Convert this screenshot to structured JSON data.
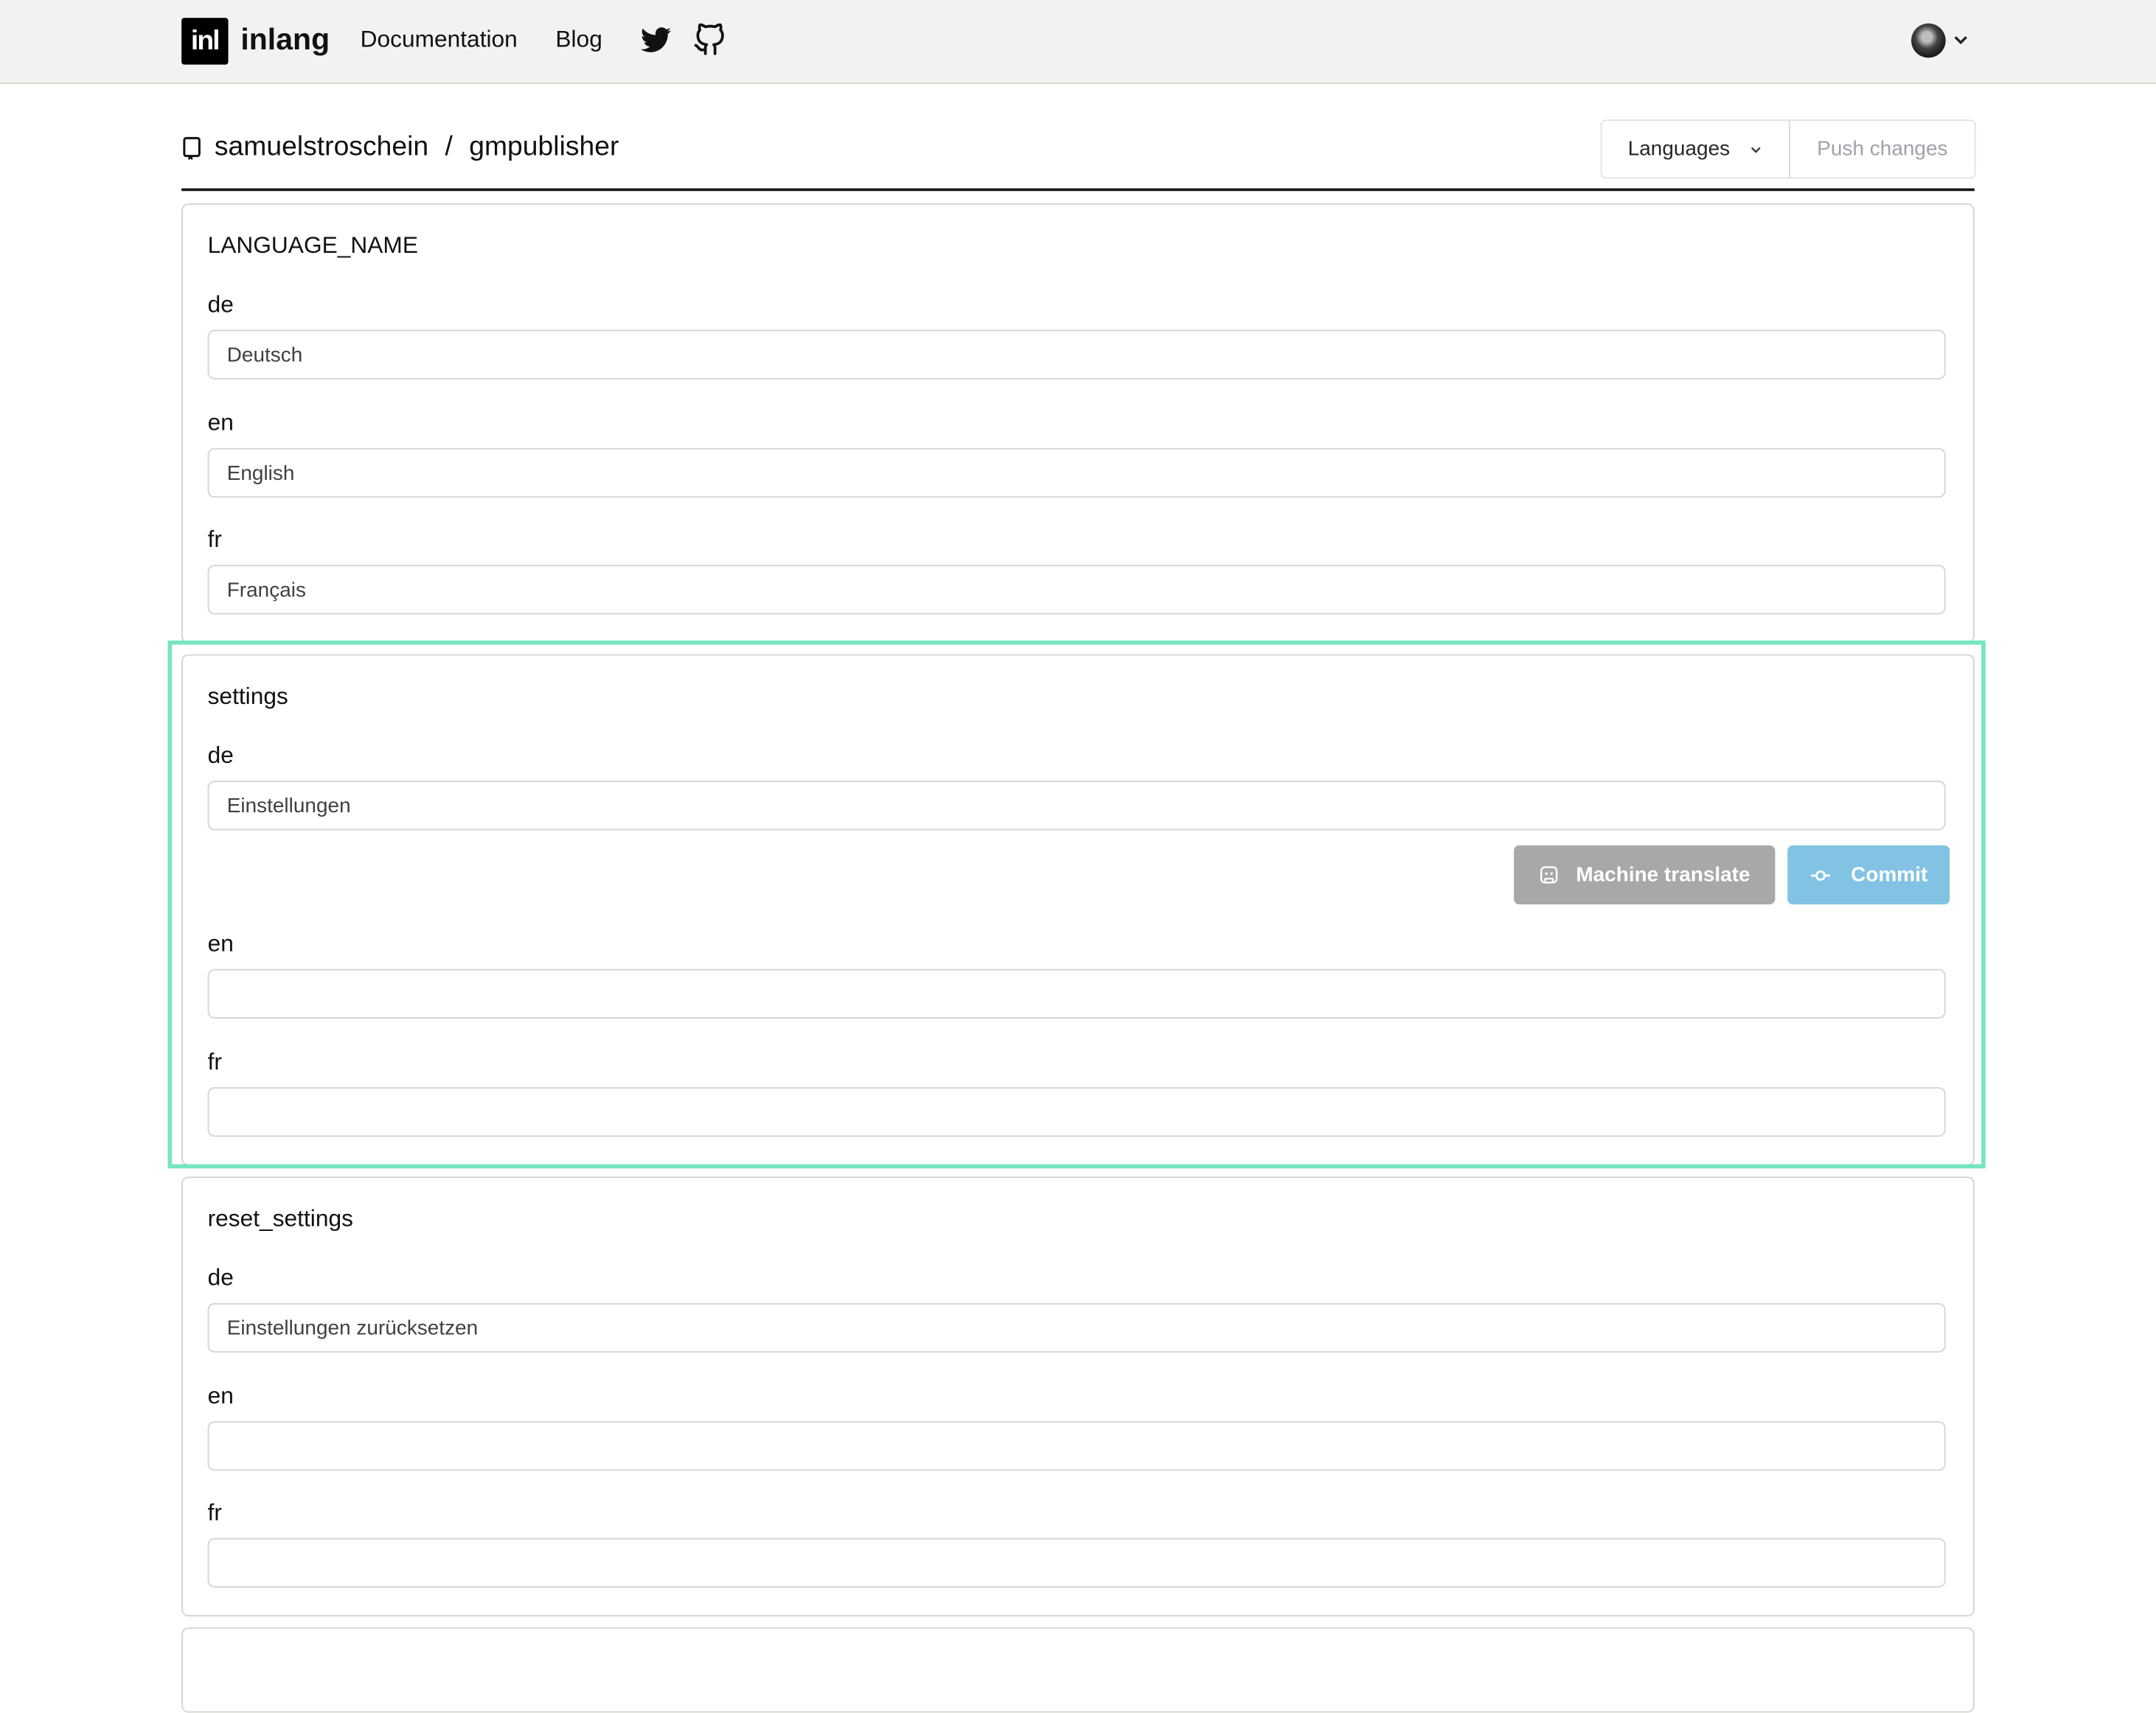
{
  "header": {
    "logo_text": "inl",
    "brand": "inlang",
    "nav": [
      {
        "label": "Documentation"
      },
      {
        "label": "Blog"
      }
    ],
    "icons": [
      "twitter-icon",
      "github-icon"
    ],
    "user_menu": {
      "avatar": "user-avatar",
      "chevron": "chevron-down-icon"
    }
  },
  "repo": {
    "owner": "samuelstroschein",
    "separator": "/",
    "name": "gmpublisher"
  },
  "toolbar": {
    "languages_label": "Languages",
    "push_label": "Push changes"
  },
  "colors": {
    "highlight": "#76e5c1",
    "machine_translate_bg": "#a8a8ab",
    "commit_bg": "#82c3e3"
  },
  "messages": [
    {
      "id": "LANGUAGE_NAME",
      "translations": [
        {
          "lang": "de",
          "value": "Deutsch"
        },
        {
          "lang": "en",
          "value": "English"
        },
        {
          "lang": "fr",
          "value": "Français"
        }
      ]
    },
    {
      "id": "settings",
      "highlighted": true,
      "translations": [
        {
          "lang": "de",
          "value": "Einstellungen"
        },
        {
          "lang": "en",
          "value": ""
        },
        {
          "lang": "fr",
          "value": ""
        }
      ],
      "actions": {
        "machine_translate_label": "Machine translate",
        "commit_label": "Commit"
      }
    },
    {
      "id": "reset_settings",
      "translations": [
        {
          "lang": "de",
          "value": "Einstellungen zurücksetzen"
        },
        {
          "lang": "en",
          "value": ""
        },
        {
          "lang": "fr",
          "value": ""
        }
      ]
    }
  ]
}
